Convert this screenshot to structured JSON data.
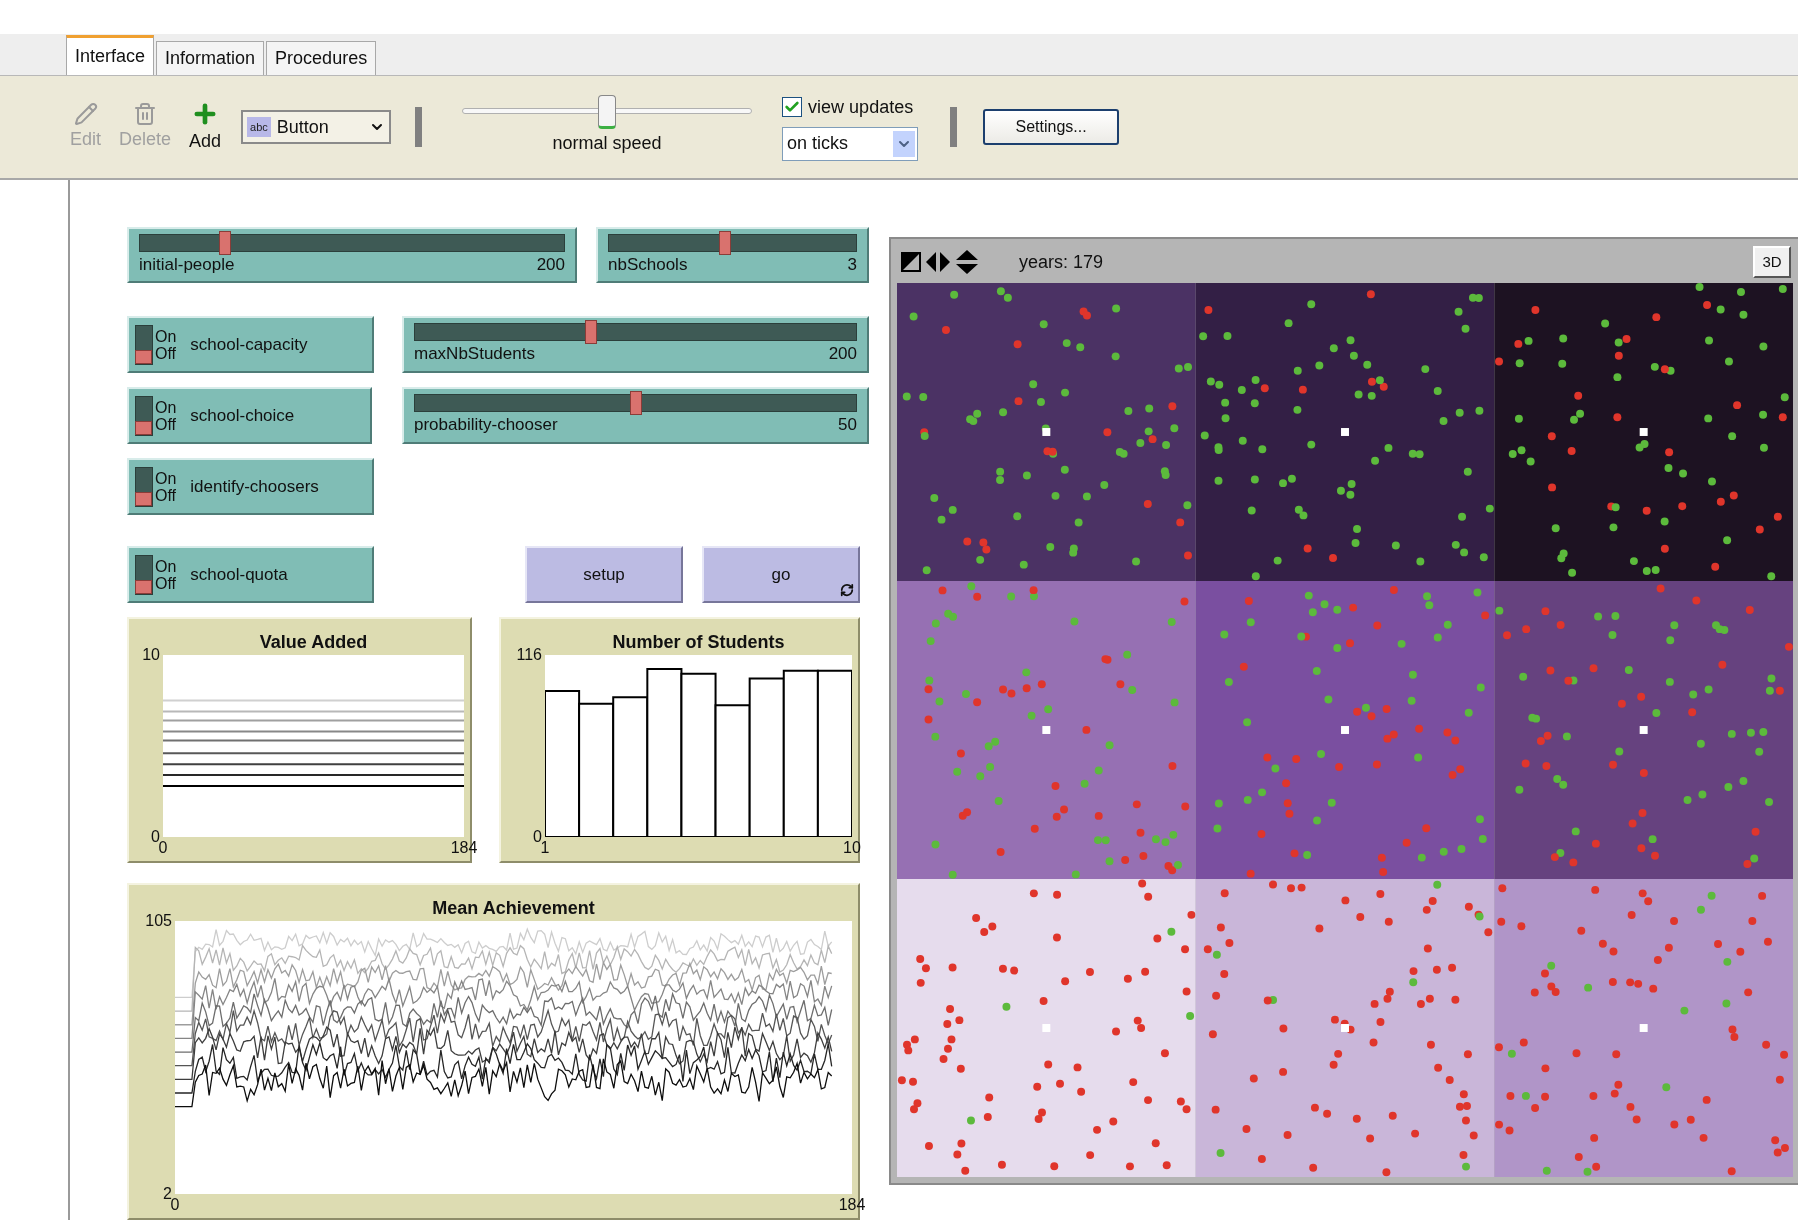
{
  "tabs": [
    {
      "label": "Interface",
      "selected": true
    },
    {
      "label": "Information",
      "selected": false
    },
    {
      "label": "Procedures",
      "selected": false
    }
  ],
  "toolbar": {
    "tools": [
      {
        "label": "Edit",
        "kind": "pencil",
        "disabled": true
      },
      {
        "label": "Delete",
        "kind": "trash",
        "disabled": true
      },
      {
        "label": "Add",
        "kind": "plus",
        "disabled": false
      }
    ],
    "widget_type": {
      "icon_text": "abc",
      "value": "Button"
    },
    "speed": {
      "level": 0.5,
      "label": "normal speed"
    },
    "view_updates": {
      "label": "view updates",
      "checked": true
    },
    "update_mode": {
      "value": "on ticks"
    },
    "settings_button": "Settings..."
  },
  "widgets": [
    {
      "kind": "slider",
      "label": "initial-people",
      "value": "200",
      "level": 0.2
    },
    {
      "kind": "slider",
      "label": "nbSchools",
      "value": "3",
      "level": 0.47
    },
    {
      "kind": "switch",
      "label": "school-capacity",
      "on_label": "On",
      "off_label": "Off",
      "on": false
    },
    {
      "kind": "slider",
      "label": "maxNbStudents",
      "value": "200",
      "level": 0.4
    },
    {
      "kind": "switch",
      "label": "school-choice",
      "on_label": "On",
      "off_label": "Off",
      "on": false
    },
    {
      "kind": "slider",
      "label": "probability-chooser",
      "value": "50",
      "level": 0.5
    },
    {
      "kind": "switch",
      "label": "identify-choosers",
      "on_label": "On",
      "off_label": "Off",
      "on": false
    },
    {
      "kind": "switch",
      "label": "school-quota",
      "on_label": "On",
      "off_label": "Off",
      "on": false
    },
    {
      "kind": "button",
      "label": "setup",
      "forever": false
    },
    {
      "kind": "button",
      "label": "go",
      "forever": true
    }
  ],
  "plots": [
    {
      "title": "Value Added",
      "chart_data": {
        "type": "line",
        "x": [
          0,
          184
        ],
        "xlim": [
          0,
          184
        ],
        "ylim": [
          0,
          10
        ],
        "xticks": [
          0,
          184
        ],
        "yticks": [
          0,
          10
        ],
        "series": [
          {
            "color": "#d0d0d0",
            "values": [
              7.5,
              7.5
            ]
          },
          {
            "color": "#b8b8b8",
            "values": [
              6.9,
              6.9
            ]
          },
          {
            "color": "#a0a0a0",
            "values": [
              6.4,
              6.4
            ]
          },
          {
            "color": "#888888",
            "values": [
              5.8,
              5.8
            ]
          },
          {
            "color": "#707070",
            "values": [
              5.3,
              5.3
            ]
          },
          {
            "color": "#585858",
            "values": [
              4.6,
              4.6
            ]
          },
          {
            "color": "#404040",
            "values": [
              4.0,
              4.0
            ]
          },
          {
            "color": "#282828",
            "values": [
              3.4,
              3.4
            ]
          },
          {
            "color": "#000000",
            "values": [
              2.8,
              2.8
            ]
          }
        ]
      }
    },
    {
      "title": "Number of Students",
      "chart_data": {
        "type": "bar",
        "x": [
          1.5,
          2.5,
          3.5,
          4.5,
          5.5,
          6.5,
          7.5,
          8.5,
          9.5
        ],
        "values": [
          93,
          85,
          89,
          107,
          104,
          84,
          101,
          106,
          106
        ],
        "xlim": [
          1,
          10
        ],
        "ylim": [
          0,
          116
        ],
        "xticks": [
          1,
          10
        ],
        "yticks": [
          0,
          116
        ]
      }
    },
    {
      "title": "Mean Achievement",
      "kind": "picture",
      "y_max": "105",
      "y_min": "2",
      "x_min": "0",
      "x_max": "184"
    }
  ],
  "view": {
    "label": "years: 179",
    "three_d_button": "3D"
  }
}
